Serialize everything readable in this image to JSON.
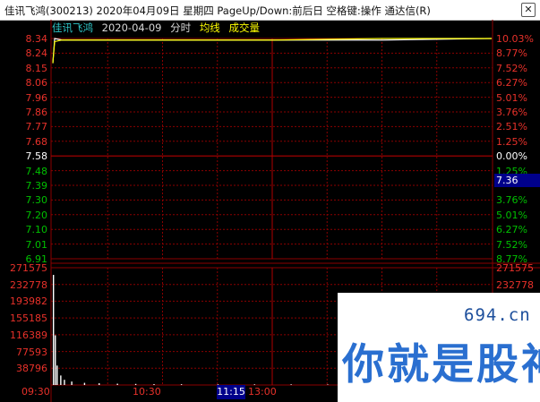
{
  "window": {
    "title": "佳讯飞鸿(300213) 2020年04月09日 星期四 PageUp/Down:前后日 空格键:操作 通达信(R)",
    "close_glyph": "✕"
  },
  "infobar": {
    "stock_name": "佳讯飞鸿",
    "date": "2020-04-09",
    "chart_mode": "分时",
    "avg_label": "均线",
    "volume_label": "成交量"
  },
  "price_axis": {
    "ticks": [
      "8.34",
      "8.24",
      "8.15",
      "8.06",
      "7.96",
      "7.86",
      "7.77",
      "7.68",
      "7.58",
      "7.48",
      "7.39",
      "7.30",
      "7.20",
      "7.10",
      "7.01",
      "6.91"
    ],
    "pct_ticks": [
      "10.03%",
      "8.77%",
      "7.52%",
      "6.27%",
      "5.01%",
      "3.76%",
      "2.51%",
      "1.25%",
      "0.00%",
      "1.25%",
      "",
      "3.76%",
      "5.01%",
      "6.27%",
      "7.52%",
      "8.77%"
    ],
    "current_price_badge": "7.36"
  },
  "volume_axis": {
    "ticks": [
      "271575",
      "232778",
      "193982",
      "155185",
      "116389",
      "77593",
      "38796"
    ]
  },
  "time_axis": {
    "labels": [
      "09:30",
      "10:30",
      "13:00"
    ],
    "cursor_badge": "11:15"
  },
  "watermark": {
    "site": "694.cn",
    "text": "你就是股神"
  },
  "colors": {
    "up": "#e8312a",
    "down": "#00c000",
    "flat": "#ffffff",
    "price_line": "#ffffff",
    "avg_line": "#ffff00",
    "grid": "#8b0000",
    "stock_name": "#2ec7c9",
    "highlight": "#00008b"
  },
  "chart_data": [
    {
      "type": "line",
      "title": "",
      "xlabel": "",
      "ylabel": "",
      "x": [
        "09:30",
        "09:31",
        "09:35",
        "10:30",
        "11:30",
        "13:00",
        "14:00",
        "15:00"
      ],
      "series": [
        {
          "name": "",
          "values": [
            8.18,
            8.34,
            8.33,
            8.33,
            8.33,
            8.33,
            8.33,
            8.34
          ]
        },
        {
          "name": "均线",
          "values": [
            8.18,
            8.32,
            8.33,
            8.33,
            8.33,
            8.33,
            8.34,
            8.34
          ]
        }
      ],
      "ylim": [
        6.91,
        8.34
      ],
      "baseline": 7.58,
      "grid": true
    },
    {
      "type": "bar",
      "x": [
        "09:30",
        "09:31",
        "09:32",
        "09:34",
        "09:36",
        "09:40",
        "09:47",
        "09:55",
        "10:05",
        "10:15",
        "10:25",
        "10:40",
        "11:00",
        "11:20",
        "13:10",
        "13:30",
        "14:00",
        "14:30"
      ],
      "values": [
        255000,
        115000,
        45000,
        22000,
        12000,
        8000,
        5000,
        4000,
        3000,
        2500,
        2000,
        1800,
        1500,
        1500,
        1500,
        1200,
        1000,
        1000
      ],
      "ylim": [
        0,
        271575
      ],
      "grid": true
    }
  ]
}
